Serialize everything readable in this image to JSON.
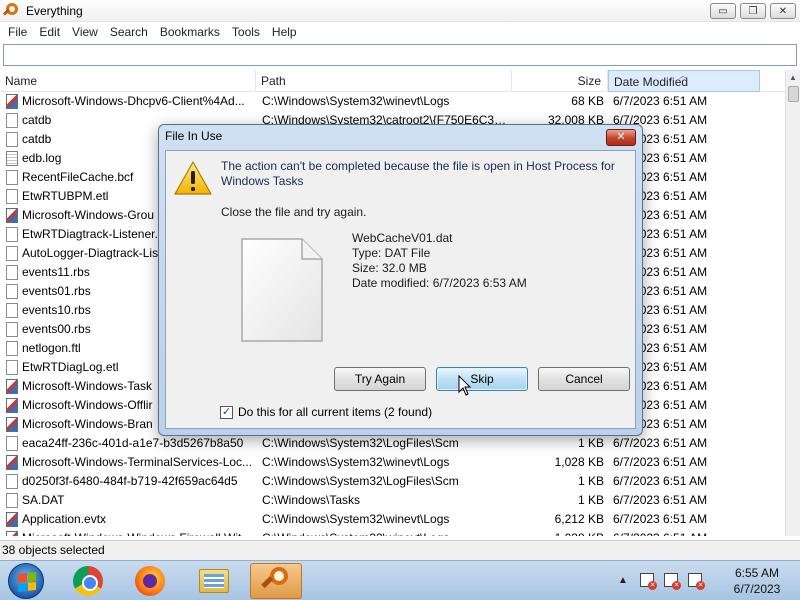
{
  "window": {
    "title": "Everything",
    "controls": [
      "▭",
      "❐",
      "✕"
    ]
  },
  "menu": [
    "File",
    "Edit",
    "View",
    "Search",
    "Bookmarks",
    "Tools",
    "Help"
  ],
  "search": {
    "value": "",
    "placeholder": ""
  },
  "columns": {
    "name": "Name",
    "path": "Path",
    "size": "Size",
    "date": "Date Modified"
  },
  "rows": [
    {
      "name": "Microsoft-Windows-Dhcpv6-Client%4Ad...",
      "path": "C:\\Windows\\System32\\winevt\\Logs",
      "size": "68 KB",
      "date": "6/7/2023 6:51 AM",
      "icon": "event-log-icon"
    },
    {
      "name": "catdb",
      "path": "C:\\Windows\\System32\\catroot2\\{F750E6C3-3...",
      "size": "32,008 KB",
      "date": "6/7/2023 6:51 AM",
      "icon": "file-icon"
    },
    {
      "name": "catdb",
      "path": "",
      "size": "",
      "date": "6/7/2023 6:51 AM",
      "icon": "file-icon"
    },
    {
      "name": "edb.log",
      "path": "",
      "size": "",
      "date": "6/7/2023 6:51 AM",
      "icon": "text-file-icon"
    },
    {
      "name": "RecentFileCache.bcf",
      "path": "",
      "size": "",
      "date": "6/7/2023 6:51 AM",
      "icon": "file-icon"
    },
    {
      "name": "EtwRTUBPM.etl",
      "path": "",
      "size": "",
      "date": "6/7/2023 6:51 AM",
      "icon": "file-icon"
    },
    {
      "name": "Microsoft-Windows-Grou",
      "path": "",
      "size": "",
      "date": "6/7/2023 6:51 AM",
      "icon": "event-log-icon"
    },
    {
      "name": "EtwRTDiagtrack-Listener.e",
      "path": "",
      "size": "",
      "date": "6/7/2023 6:51 AM",
      "icon": "file-icon"
    },
    {
      "name": "AutoLogger-Diagtrack-Lis",
      "path": "",
      "size": "",
      "date": "6/7/2023 6:51 AM",
      "icon": "file-icon"
    },
    {
      "name": "events11.rbs",
      "path": "",
      "size": "",
      "date": "6/7/2023 6:51 AM",
      "icon": "file-icon"
    },
    {
      "name": "events01.rbs",
      "path": "",
      "size": "",
      "date": "6/7/2023 6:51 AM",
      "icon": "file-icon"
    },
    {
      "name": "events10.rbs",
      "path": "",
      "size": "",
      "date": "6/7/2023 6:51 AM",
      "icon": "file-icon"
    },
    {
      "name": "events00.rbs",
      "path": "",
      "size": "",
      "date": "6/7/2023 6:51 AM",
      "icon": "file-icon"
    },
    {
      "name": "netlogon.ftl",
      "path": "",
      "size": "",
      "date": "6/7/2023 6:51 AM",
      "icon": "file-icon"
    },
    {
      "name": "EtwRTDiagLog.etl",
      "path": "",
      "size": "",
      "date": "6/7/2023 6:51 AM",
      "icon": "file-icon"
    },
    {
      "name": "Microsoft-Windows-Task",
      "path": "",
      "size": "",
      "date": "6/7/2023 6:51 AM",
      "icon": "event-log-icon"
    },
    {
      "name": "Microsoft-Windows-Offlir",
      "path": "",
      "size": "",
      "date": "6/7/2023 6:51 AM",
      "icon": "event-log-icon"
    },
    {
      "name": "Microsoft-Windows-Bran",
      "path": "",
      "size": "",
      "date": "6/7/2023 6:51 AM",
      "icon": "event-log-icon"
    },
    {
      "name": "eaca24ff-236c-401d-a1e7-b3d5267b8a50",
      "path": "C:\\Windows\\System32\\LogFiles\\Scm",
      "size": "1 KB",
      "date": "6/7/2023 6:51 AM",
      "icon": "file-icon"
    },
    {
      "name": "Microsoft-Windows-TerminalServices-Loc...",
      "path": "C:\\Windows\\System32\\winevt\\Logs",
      "size": "1,028 KB",
      "date": "6/7/2023 6:51 AM",
      "icon": "event-log-icon"
    },
    {
      "name": "d0250f3f-6480-484f-b719-42f659ac64d5",
      "path": "C:\\Windows\\System32\\LogFiles\\Scm",
      "size": "1 KB",
      "date": "6/7/2023 6:51 AM",
      "icon": "file-icon"
    },
    {
      "name": "SA.DAT",
      "path": "C:\\Windows\\Tasks",
      "size": "1 KB",
      "date": "6/7/2023 6:51 AM",
      "icon": "file-icon"
    },
    {
      "name": "Application.evtx",
      "path": "C:\\Windows\\System32\\winevt\\Logs",
      "size": "6,212 KB",
      "date": "6/7/2023 6:51 AM",
      "icon": "event-log-icon"
    },
    {
      "name": "Microsoft-Windows-Windows Firewall With...",
      "path": "C:\\Windows\\System32\\winevt\\Logs",
      "size": "1,028 KB",
      "date": "6/7/2023 6:51 AM",
      "icon": "event-log-icon"
    }
  ],
  "status": "38 objects selected",
  "taskbar": {
    "apps": [
      "start-icon",
      "chrome-icon",
      "firefox-icon",
      "file-explorer-icon",
      "everything-icon"
    ],
    "time": "6:55 AM",
    "date": "6/7/2023"
  },
  "dialog": {
    "title": "File In Use",
    "close_label": "✕",
    "message": "The action can't be completed because the file is open in Host Process for Windows Tasks",
    "instruction": "Close the file and try again.",
    "file_name": "WebCacheV01.dat",
    "file_type": "Type: DAT File",
    "file_size": "Size: 32.0 MB",
    "file_date": "Date modified: 6/7/2023 6:53 AM",
    "buttons": {
      "try_again": "Try Again",
      "skip": "Skip",
      "cancel": "Cancel"
    },
    "checkbox_label": "Do this for all current items (2 found)",
    "checkbox_checked": true
  },
  "colors": {
    "sort_column_bg": "#dcecfc",
    "dialog_frame": "#b9d1ea",
    "focus_button": "#bfe0f6",
    "close_red": "#c5432a"
  }
}
